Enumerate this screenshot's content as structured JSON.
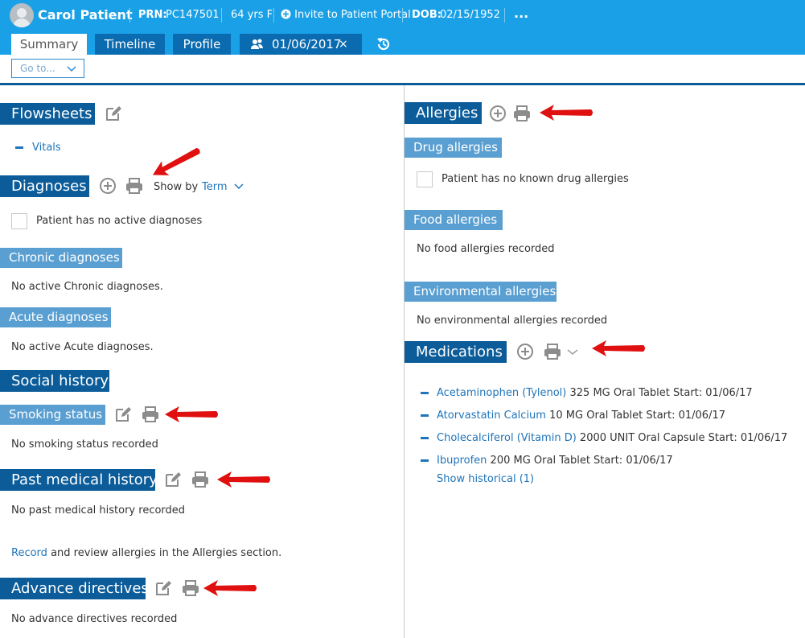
{
  "header": {
    "patient_name": "Carol Patient",
    "prn_label": "PRN:",
    "prn_value": "PC147501",
    "age_sex": "64 yrs F",
    "portal_invite": "Invite to Patient Portal",
    "dob_label": "DOB:",
    "dob_value": "02/15/1952",
    "more": "..."
  },
  "tabs": {
    "summary": "Summary",
    "timeline": "Timeline",
    "profile": "Profile",
    "encounter_date": "01/06/2017",
    "encounter_close": "×"
  },
  "goto": {
    "label": "Go to..."
  },
  "flowsheets": {
    "title": "Flowsheets",
    "vitals": "Vitals"
  },
  "diagnoses": {
    "title": "Diagnoses",
    "show_by_label": "Show by",
    "show_by_value": "Term",
    "no_active": "Patient has no active diagnoses",
    "chronic_title": "Chronic diagnoses",
    "chronic_empty": "No active Chronic diagnoses.",
    "acute_title": "Acute diagnoses",
    "acute_empty": "No active Acute diagnoses."
  },
  "social_history": {
    "title": "Social history",
    "smoking_title": "Smoking status",
    "smoking_empty": "No smoking status recorded"
  },
  "past_medical_history": {
    "title": "Past medical history",
    "empty": "No past medical history recorded",
    "record_link": "Record",
    "record_note": "and review allergies in the Allergies section."
  },
  "advance_directives": {
    "title": "Advance directives",
    "empty": "No advance directives recorded"
  },
  "allergies": {
    "title": "Allergies",
    "drug_title": "Drug allergies",
    "drug_none": "Patient has no known drug allergies",
    "food_title": "Food allergies",
    "food_empty": "No food allergies recorded",
    "env_title": "Environmental allergies",
    "env_empty": "No environmental allergies recorded"
  },
  "medications": {
    "title": "Medications",
    "items": [
      {
        "name": "Acetaminophen (Tylenol)",
        "detail": "325 MG Oral Tablet Start: 01/06/17"
      },
      {
        "name": "Atorvastatin Calcium",
        "detail": "10 MG Oral Tablet Start: 01/06/17"
      },
      {
        "name": "Cholecalciferol (Vitamin D)",
        "detail": "2000 UNIT Oral Capsule Start: 01/06/17"
      },
      {
        "name": "Ibuprofen",
        "detail": "200 MG Oral Tablet Start: 01/06/17"
      }
    ],
    "show_historical": "Show historical (1)"
  },
  "colors": {
    "header_bg": "#1aa0e6",
    "section_bg": "#0b5c99",
    "subsection_bg": "#5a9fd1",
    "link": "#1f74ba",
    "annotation_arrow": "#e01010"
  }
}
